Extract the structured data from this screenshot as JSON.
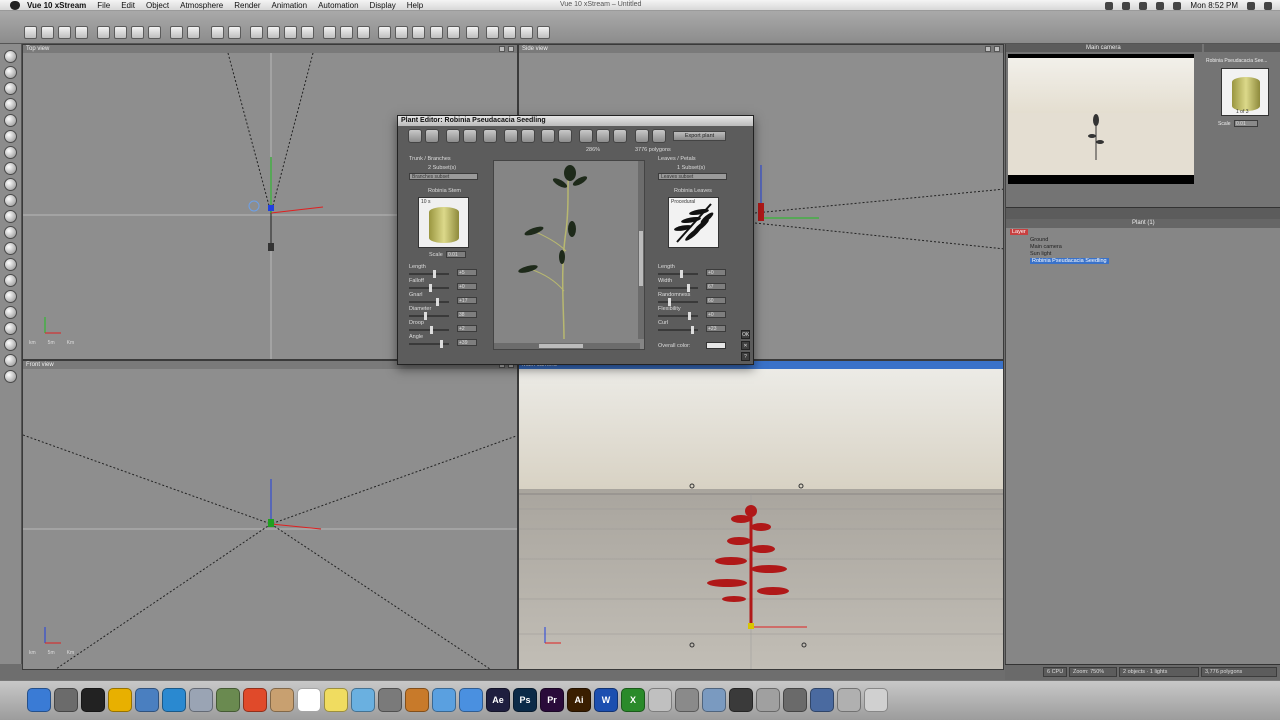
{
  "menubar": {
    "app_name": "Vue 10 xStream",
    "items": [
      "File",
      "Edit",
      "Object",
      "Atmosphere",
      "Render",
      "Animation",
      "Automation",
      "Display",
      "Help"
    ],
    "window_title": "Vue 10 xStream – Untitled",
    "clock": "Mon 8:52 PM"
  },
  "viewports": {
    "top": {
      "title": "Top view",
      "scale_labels": [
        "km",
        "5m",
        "Km"
      ]
    },
    "side": {
      "title": "Side view"
    },
    "front": {
      "title": "Front view",
      "scale_labels": [
        "km",
        "5m",
        "Km"
      ]
    },
    "main": {
      "title": "Main camera"
    }
  },
  "plant_editor": {
    "title": "Plant Editor:  Robinia Pseudacacia Seedling",
    "export_button": "Export plant",
    "zoom": "286%",
    "polygons": "3776 polygons",
    "trunk": {
      "section": "Trunk / Branches",
      "subsets": "2 Subset(s)",
      "subset_dropdown": "Branches subset",
      "material": "Robinia Stem",
      "material_thumb": "10 s",
      "scale_label": "Scale",
      "scale_value": "0.01",
      "params": [
        {
          "label": "Length",
          "value": "+5"
        },
        {
          "label": "Falloff",
          "value": "+0"
        },
        {
          "label": "Gnarl",
          "value": "+17"
        },
        {
          "label": "Diameter",
          "value": "38"
        },
        {
          "label": "Droop",
          "value": "+2"
        },
        {
          "label": "Angle",
          "value": "+39"
        }
      ]
    },
    "leaves": {
      "section": "Leaves / Petals",
      "subsets": "1 Subset(s)",
      "subset_dropdown": "Leaves subset",
      "material": "Robinia Leaves",
      "material_thumb": "Procedural",
      "params": [
        {
          "label": "Length",
          "value": "+0"
        },
        {
          "label": "Width",
          "value": "67"
        },
        {
          "label": "Randomness",
          "value": "60"
        },
        {
          "label": "Flexibility",
          "value": "+0"
        },
        {
          "label": "Curl",
          "value": "+23"
        }
      ],
      "color_label": "Overall color:"
    },
    "ok_button": "OK",
    "cancel_button": "✕",
    "help_button": "?"
  },
  "right_panel": {
    "camera_title": "Main camera",
    "material_title": "Robinia Pseudacacia See...",
    "material_count": "1 of 3",
    "scale_label": "Scale",
    "scale_value": "0.01",
    "world_browser_title": "Plant (1)",
    "tree": [
      "Ground",
      "Main camera",
      "Sun light",
      "Robinia Pseudacacia Seedling"
    ],
    "tree_root": "Layer"
  },
  "status": {
    "cpu": "6 CPU",
    "zoom": "Zoom: 750%",
    "objects": "2 objects · 1 lights",
    "polygons": "3,776 polygons"
  },
  "dock": {
    "labeled_apps": [
      {
        "name": "after-effects",
        "label": "Ae",
        "color": "#1f1f3f"
      },
      {
        "name": "photoshop",
        "label": "Ps",
        "color": "#0b2a48"
      },
      {
        "name": "premiere",
        "label": "Pr",
        "color": "#2a0b3a"
      },
      {
        "name": "illustrator",
        "label": "Ai",
        "color": "#3a1e00"
      },
      {
        "name": "word",
        "label": "W",
        "color": "#1c4fb0"
      },
      {
        "name": "xcode-x",
        "label": "X",
        "color": "#2a8a2a"
      }
    ],
    "calendar_day": "13"
  },
  "colors": {
    "accent": "#3a72c9",
    "axis_x": "#e02020",
    "axis_y": "#20c020",
    "axis_z": "#2040e0",
    "plant_red": "#b01818"
  }
}
